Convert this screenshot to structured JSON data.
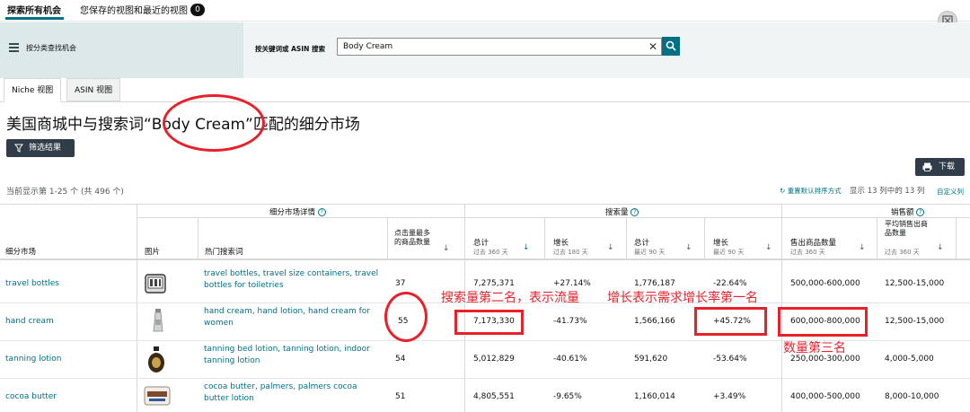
{
  "top_tabs": {
    "explore": "探索所有机会",
    "saved": "您保存的视图和最近的视图",
    "saved_count": "0"
  },
  "search_band": {
    "filter_label": "按分类查找机会",
    "search_label": "按关键词或 ASIN 搜索",
    "search_value": "Body Cream"
  },
  "view_tabs": {
    "niche": "Niche 视图",
    "asin": "ASIN 视图"
  },
  "page_title": "美国商城中与搜索词“Body Cream”匹配的细分市场",
  "filter_button": "筛选结果",
  "download_button": "下载",
  "results_count": "当前显示第 1-25 个 (共 496 个)",
  "reset_sort": "重置默认排序方式",
  "cols_count": "显示 13 列中的 13 列",
  "custom_cols": "自定义列",
  "table": {
    "group_headers": {
      "details": "细分市场详情",
      "search": "搜索量",
      "sales": "销售额"
    },
    "headers": {
      "niche": "细分市场",
      "image": "图片",
      "hot_terms": "热门搜索词",
      "top_clicked": "点击量最多的商品数量",
      "total_360": "总计",
      "total_360_sub": "过去 360 天",
      "growth_180": "增长",
      "growth_180_sub": "过去 180 天",
      "total_90": "总计",
      "total_90_sub": "最近 90 天",
      "growth_90": "增长",
      "growth_90_sub": "最近 90 天",
      "units_sold": "售出商品数量",
      "units_sold_sub": "过去 360 天",
      "avg_units": "平均销售出商品数量",
      "avg_units_sub": "过去 360 天"
    },
    "rows": [
      {
        "niche": "travel bottles",
        "terms": "travel bottles, travel size containers, travel bottles for toiletries",
        "top_clicked": "37",
        "total_360": "7,275,371",
        "growth_180": "+27.14%",
        "total_90": "1,776,187",
        "growth_90": "-22.64%",
        "units_sold": "500,000-600,000",
        "avg_units": "12,500-15,000"
      },
      {
        "niche": "hand cream",
        "terms": "hand cream, hand lotion, hand cream for women",
        "top_clicked": "55",
        "total_360": "7,173,330",
        "growth_180": "-41.73%",
        "total_90": "1,566,166",
        "growth_90": "+45.72%",
        "units_sold": "600,000-800,000",
        "avg_units": "12,500-15,000"
      },
      {
        "niche": "tanning lotion",
        "terms": "tanning bed lotion, tanning lotion, indoor tanning lotion",
        "top_clicked": "54",
        "total_360": "5,012,829",
        "growth_180": "-40.61%",
        "total_90": "591,620",
        "growth_90": "-53.64%",
        "units_sold": "250,000-300,000",
        "avg_units": "4,000-5,000"
      },
      {
        "niche": "cocoa butter",
        "terms": "cocoa butter, palmers, palmers cocoa butter lotion",
        "top_clicked": "51",
        "total_360": "4,805,551",
        "growth_180": "-9.65%",
        "total_90": "1,160,014",
        "growth_90": "+3.49%",
        "units_sold": "400,000-500,000",
        "avg_units": "8,000-10,000"
      }
    ]
  },
  "annotations": {
    "search_rank": "搜索量第二名，表示流量",
    "growth_rank": "增长表示需求增长率第一名",
    "units_rank": "数量第三名"
  },
  "colors": {
    "accent": "#007185",
    "annotation": "#e8202a",
    "button_dark": "#303c48"
  }
}
